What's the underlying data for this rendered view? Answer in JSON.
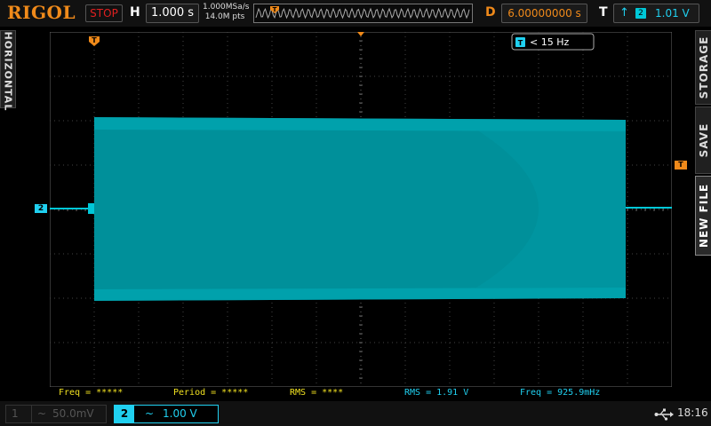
{
  "colors": {
    "ch2": "#00c8d8",
    "trigger": "#f08a1a",
    "stop": "#e02020",
    "meas_yellow": "#f0e020",
    "meas_cyan": "#20d0f0"
  },
  "header": {
    "brand": "RIGOL",
    "run_state": "STOP",
    "horizontal_label": "H",
    "timebase": "1.000 s",
    "sample_rate": "1.000MSa/s",
    "memory_depth": "14.0M pts",
    "delay_label": "D",
    "delay": "6.00000000 s",
    "trigger_label": "T",
    "trigger_channel": "2",
    "trigger_level": "1.01 V",
    "trigger_marker": "T"
  },
  "left_tab": {
    "label": "HORIZONTAL"
  },
  "right_tabs": {
    "storage": "STORAGE",
    "save": "SAVE",
    "new_file": "NEW FILE"
  },
  "screen": {
    "freq_counter": "< 15 Hz",
    "freq_counter_icon": "T",
    "ch2_marker": "2",
    "trigger_position_marker": "T",
    "trigger_level_marker": "T"
  },
  "measurements": [
    {
      "label": "Freq = *****",
      "color": "yellow"
    },
    {
      "label": "Period = *****",
      "color": "yellow"
    },
    {
      "label": "RMS = ****",
      "color": "yellow"
    },
    {
      "label": "RMS = 1.91 V",
      "color": "cyan"
    },
    {
      "label": "Freq = 925.9mHz",
      "color": "cyan"
    }
  ],
  "footer": {
    "ch1": {
      "number": "1",
      "coupling": "~",
      "scale": "50.0mV"
    },
    "ch2": {
      "number": "2",
      "coupling": "~",
      "scale": "1.00 V"
    },
    "usb_icon": "usb-icon",
    "time": "18:16"
  }
}
